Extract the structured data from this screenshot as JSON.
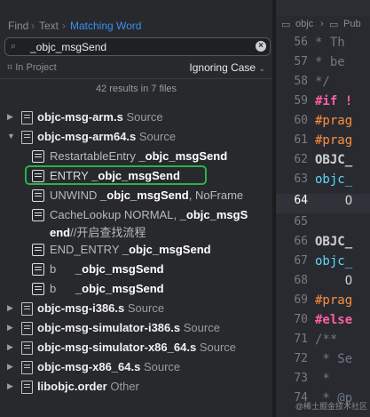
{
  "navigator": {
    "breadcrumbs": [
      "Find",
      "Text",
      "Matching Word"
    ],
    "search_value": "_objc_msgSend",
    "scope": "In Project",
    "match_mode": "Ignoring Case",
    "summary": "42 results in 7 files"
  },
  "files": [
    {
      "name": "objc-msg-arm.s",
      "lang": "Source",
      "expanded": false
    },
    {
      "name": "objc-msg-arm64.s",
      "lang": "Source",
      "expanded": true
    },
    {
      "name": "objc-msg-i386.s",
      "lang": "Source",
      "expanded": false
    },
    {
      "name": "objc-msg-simulator-i386.s",
      "lang": "Source",
      "expanded": false
    },
    {
      "name": "objc-msg-simulator-x86_64.s",
      "lang": "Source",
      "expanded": false
    },
    {
      "name": "objc-msg-x86_64.s",
      "lang": "Source",
      "expanded": false
    },
    {
      "name": "libobjc.order",
      "lang": "Other",
      "expanded": false
    }
  ],
  "matches": [
    {
      "pre": "RestartableEntry ",
      "hit": "_objc_msgSend",
      "post": ""
    },
    {
      "pre": "ENTRY ",
      "hit": "_objc_msgSend",
      "post": ""
    },
    {
      "pre": "UNWIND ",
      "hit": "_objc_msgSend",
      "post": ", NoFrame"
    },
    {
      "pre": "CacheLookup NORMAL, ",
      "hit": "_objc_msgS",
      "post": ""
    },
    {
      "pre": "",
      "hit": "end",
      "post": "//开启查找流程"
    },
    {
      "pre": "END_ENTRY ",
      "hit": "_objc_msgSend",
      "post": ""
    },
    {
      "pre": "b      ",
      "hit": "_objc_msgSend",
      "post": ""
    },
    {
      "pre": "b      ",
      "hit": "_objc_msgSend",
      "post": ""
    }
  ],
  "editor": {
    "tabs": [
      "objc",
      "Pub"
    ],
    "lines": [
      {
        "num": "56",
        "text": " * Th"
      },
      {
        "num": "57",
        "text": " * be"
      },
      {
        "num": "58",
        "text": " */"
      },
      {
        "num": "59",
        "text": "#if !"
      },
      {
        "num": "60",
        "text": "#prag"
      },
      {
        "num": "61",
        "text": "#prag"
      },
      {
        "num": "62",
        "text": "OBJC_"
      },
      {
        "num": "63",
        "text": "objc_"
      },
      {
        "num": "64",
        "text": "    O"
      },
      {
        "num": "65",
        "text": ""
      },
      {
        "num": "66",
        "text": "OBJC_"
      },
      {
        "num": "67",
        "text": "objc_"
      },
      {
        "num": "68",
        "text": "    O"
      },
      {
        "num": "69",
        "text": "#prag"
      },
      {
        "num": "70",
        "text": "#else"
      },
      {
        "num": "71",
        "text": "/**"
      },
      {
        "num": "72",
        "text": " * Se"
      },
      {
        "num": "73",
        "text": " *"
      },
      {
        "num": "74",
        "text": " * @p"
      }
    ],
    "current_line": "64"
  },
  "watermark": "@稀土掘金技术社区"
}
